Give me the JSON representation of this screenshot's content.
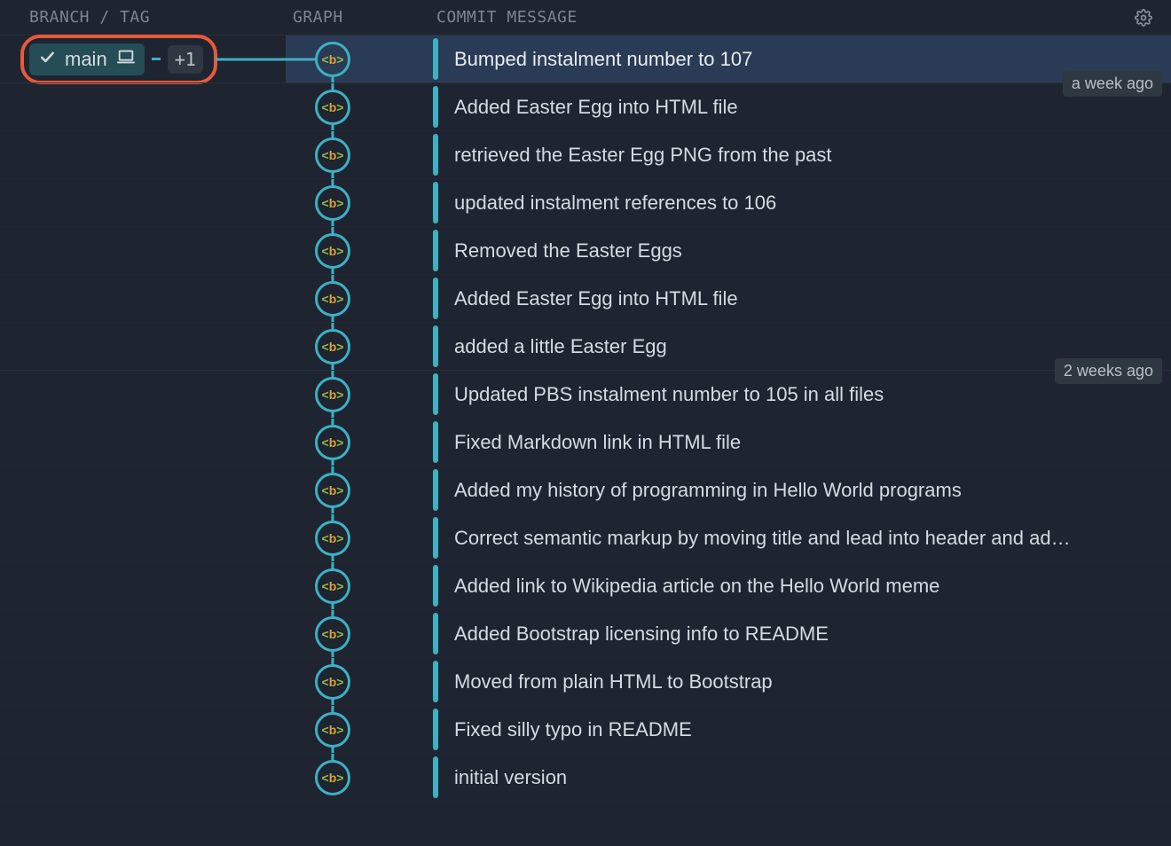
{
  "headers": {
    "branch": "BRANCH / TAG",
    "graph": "GRAPH",
    "message": "COMMIT MESSAGE"
  },
  "gear_icon": "gear-icon",
  "branch_pill": {
    "checkmark_icon": "check-icon",
    "name": "main",
    "laptop_icon": "laptop-icon",
    "extra_count": "+1"
  },
  "node_glyph": {
    "lt": "<",
    "b": "b",
    "gt": ">"
  },
  "time_badges": [
    {
      "after_row": 0,
      "label": "a week ago"
    },
    {
      "after_row": 6,
      "label": "2 weeks ago"
    }
  ],
  "commits": [
    {
      "message": "Bumped instalment number to 107",
      "selected": true,
      "has_branch_pill": true
    },
    {
      "message": "Added Easter Egg into HTML file"
    },
    {
      "message": "retrieved the Easter Egg PNG from the past"
    },
    {
      "message": "updated instalment references to 106"
    },
    {
      "message": "Removed the Easter Eggs"
    },
    {
      "message": "Added Easter Egg into HTML file"
    },
    {
      "message": "added a little Easter Egg"
    },
    {
      "message": "Updated PBS instalment number to 105 in all files"
    },
    {
      "message": "Fixed Markdown link in HTML file"
    },
    {
      "message": "Added my history of programming in Hello World programs"
    },
    {
      "message": "Correct semantic markup by moving title and lead into header and ad…"
    },
    {
      "message": "Added link to Wikipedia article on the Hello World meme"
    },
    {
      "message": "Added Bootstrap licensing info to README"
    },
    {
      "message": "Moved from plain HTML to Bootstrap"
    },
    {
      "message": "Fixed silly typo in README"
    },
    {
      "message": "initial version"
    }
  ]
}
